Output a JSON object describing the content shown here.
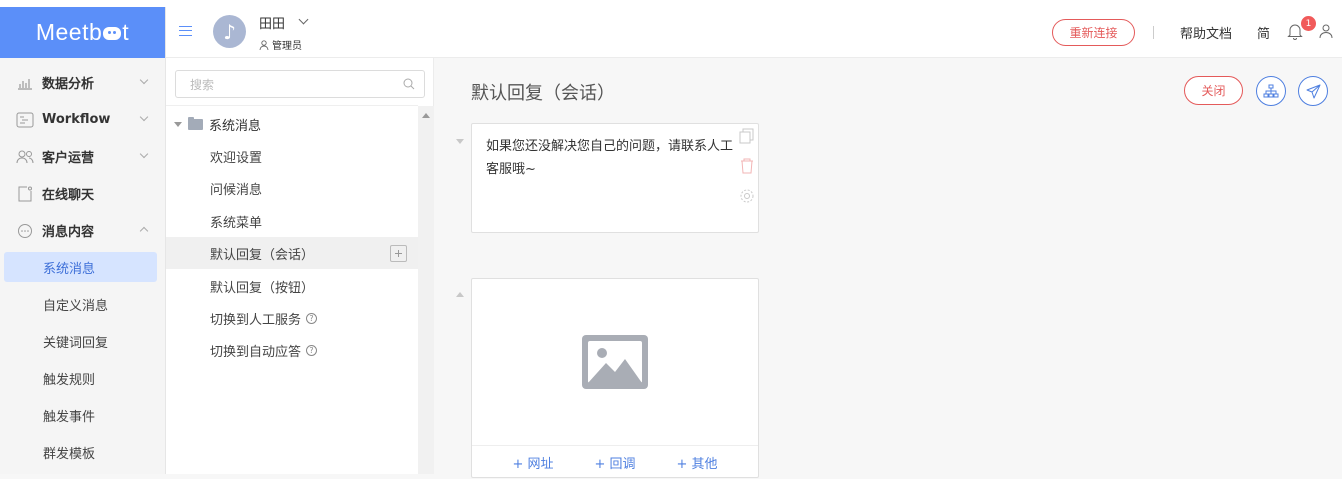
{
  "logo": {
    "text_prefix": "Meetb",
    "text_suffix": "t"
  },
  "sidebar": {
    "items": [
      {
        "label": "数据分析",
        "icon": "chart-icon"
      },
      {
        "label": "Workflow",
        "icon": "workflow-icon"
      },
      {
        "label": "客户运营",
        "icon": "users-icon"
      },
      {
        "label": "在线聊天",
        "icon": "chat-icon"
      },
      {
        "label": "消息内容",
        "icon": "message-icon"
      }
    ],
    "subitems": [
      "系统消息",
      "自定义消息",
      "关键词回复",
      "触发规则",
      "触发事件",
      "群发模板"
    ]
  },
  "header": {
    "user_name": "田田",
    "avatar_glyph": "♪",
    "user_role": "管理员",
    "reconnect_label": "重新连接",
    "help_label": "帮助文档",
    "lang_label": "简",
    "notification_count": "1"
  },
  "tree": {
    "search_placeholder": "搜索",
    "root_label": "系统消息",
    "nodes": [
      "欢迎设置",
      "问候消息",
      "系统菜单",
      "默认回复（会话）",
      "默认回复（按钮）",
      "切换到人工服务",
      "切换到自动应答"
    ],
    "help_glyph": "?"
  },
  "content": {
    "title": "默认回复（会话）",
    "close_label": "关闭",
    "message_text": "如果您还没解决您自己的问题，请联系人工客服哦~",
    "actions": [
      "+ 网址",
      "+ 回调",
      "+ 其他"
    ]
  },
  "colors": {
    "accent": "#5b8ff9",
    "danger": "#e45a5a",
    "active_bg": "#d6e4ff"
  }
}
